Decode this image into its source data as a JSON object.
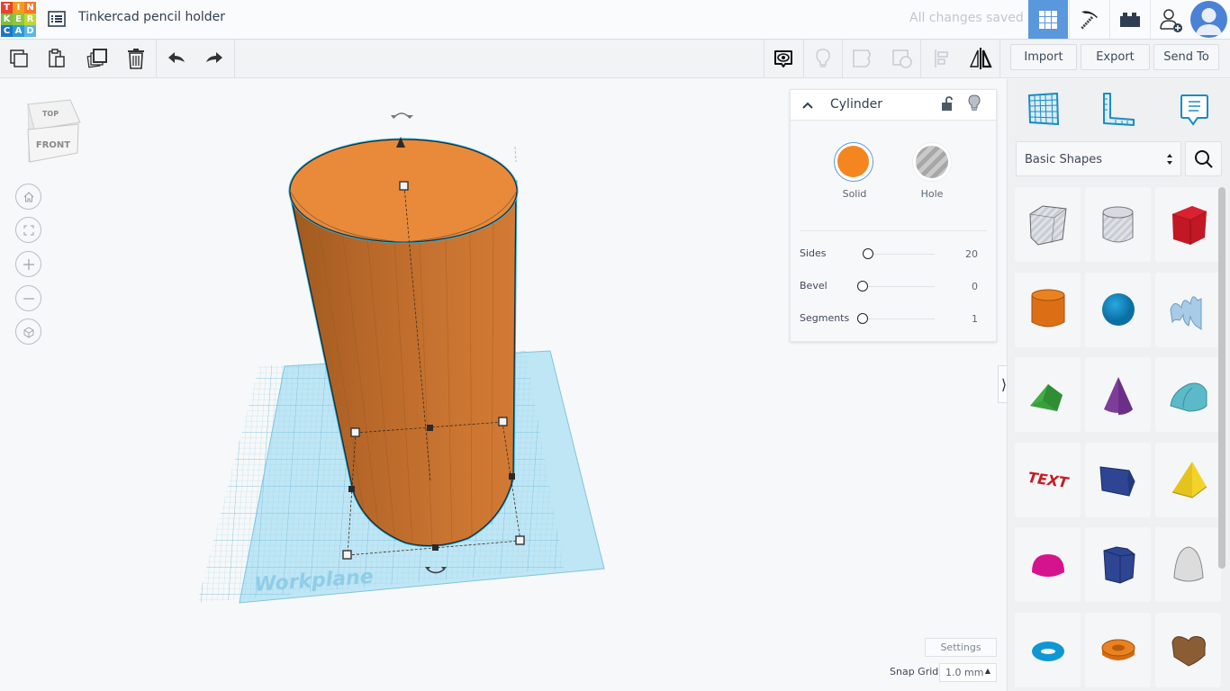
{
  "header": {
    "logo_letters": [
      "T",
      "I",
      "N",
      "K",
      "E",
      "R",
      "C",
      "A",
      "D"
    ],
    "logo_colors": [
      "#e8412d",
      "#f29c1f",
      "#f7772a",
      "#7fbc42",
      "#8dc63f",
      "#bfd730",
      "#1f75c1",
      "#2c9ad6",
      "#5cb7e6"
    ],
    "title": "Tinkercad pencil holder",
    "save_status": "All changes saved",
    "accent": "#5b97dc"
  },
  "toolbar": {
    "import_label": "Import",
    "export_label": "Export",
    "send_to_label": "Send To"
  },
  "viewport": {
    "viewcube_top": "TOP",
    "viewcube_front": "FRONT",
    "workplane_label": "Workplane",
    "object_color": "#e8893a",
    "workplane_color": "#a8dcf0"
  },
  "inspector": {
    "title": "Cylinder",
    "solid_label": "Solid",
    "hole_label": "Hole",
    "solid_color": "#f5861f",
    "properties": [
      {
        "label": "Sides",
        "value": "20",
        "fraction": 0.08
      },
      {
        "label": "Bevel",
        "value": "0",
        "fraction": 0.0
      },
      {
        "label": "Segments",
        "value": "1",
        "fraction": 0.0
      }
    ]
  },
  "shapes_panel": {
    "category": "Basic Shapes",
    "shapes": [
      {
        "name": "Box Hole"
      },
      {
        "name": "Cylinder Hole"
      },
      {
        "name": "Box"
      },
      {
        "name": "Cylinder"
      },
      {
        "name": "Sphere"
      },
      {
        "name": "Scribble"
      },
      {
        "name": "Roof"
      },
      {
        "name": "Cone"
      },
      {
        "name": "Round Roof"
      },
      {
        "name": "Text"
      },
      {
        "name": "Wedge"
      },
      {
        "name": "Pyramid"
      },
      {
        "name": "Half Sphere"
      },
      {
        "name": "Polygon"
      },
      {
        "name": "Paraboloid"
      },
      {
        "name": "Torus"
      },
      {
        "name": "Tube"
      },
      {
        "name": "Heart"
      }
    ],
    "text_shape_label": "TEXT"
  },
  "footer": {
    "settings_label": "Settings",
    "snap_grid_label": "Snap Grid",
    "snap_grid_value": "1.0 mm"
  }
}
